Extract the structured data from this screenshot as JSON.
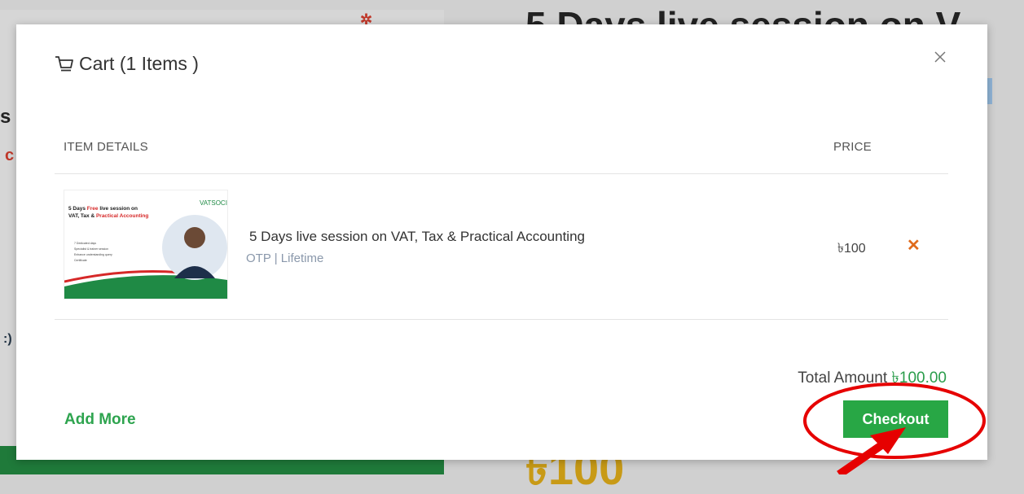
{
  "background": {
    "heading": "5 Days live session on V",
    "price": "৳100",
    "side_s": "s",
    "side_c": "c",
    "side_p": ":)"
  },
  "cart": {
    "title": "Cart (1 Items )",
    "columns": {
      "item": "ITEM DETAILS",
      "price": "PRICE"
    },
    "items": [
      {
        "name": "5 Days live session on VAT, Tax & Practical Accounting",
        "meta": "OTP | Lifetime",
        "price": "৳100",
        "thumbnail": {
          "headline_1": "5 Days ",
          "headline_free": "Free",
          "headline_2": " live session on",
          "headline_3": "VAT, Tax & ",
          "headline_practical": "Practical Accounting",
          "bullets": [
            "7 Dedicated days",
            "Specialist & trainer session",
            "Enhance understanding query",
            "Certificate"
          ],
          "logo_text": "VATSOCIETY"
        }
      }
    ],
    "total_label": "Total Amount ",
    "total_value": "৳100.00",
    "add_more": "Add More",
    "checkout": "Checkout"
  },
  "colors": {
    "accent": "#28a745",
    "remove": "#e06b1c",
    "annotation": "#e60000"
  },
  "icons": {
    "cart": "cart-icon",
    "close": "close-icon",
    "remove": "remove-icon"
  }
}
